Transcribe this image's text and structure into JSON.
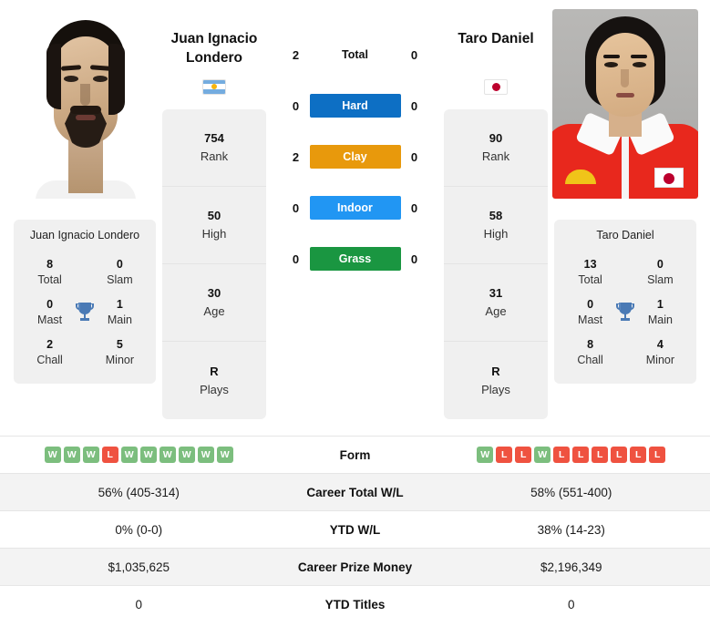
{
  "players": {
    "left": {
      "name": "Juan Ignacio Londero",
      "name_line1": "Juan Ignacio",
      "name_line2": "Londero",
      "country": "Argentina",
      "flag": "argentina-flag",
      "photo_alt": "Juan Ignacio Londero headshot",
      "card": [
        {
          "value": "754",
          "label": "Rank"
        },
        {
          "value": "50",
          "label": "High"
        },
        {
          "value": "30",
          "label": "Age"
        },
        {
          "value": "R",
          "label": "Plays"
        }
      ],
      "titles": {
        "heading": "Juan Ignacio Londero",
        "total": {
          "value": "8",
          "label": "Total"
        },
        "slam": {
          "value": "0",
          "label": "Slam"
        },
        "mast": {
          "value": "0",
          "label": "Mast"
        },
        "main": {
          "value": "1",
          "label": "Main"
        },
        "chall": {
          "value": "2",
          "label": "Chall"
        },
        "minor": {
          "value": "5",
          "label": "Minor"
        }
      },
      "form": [
        "W",
        "W",
        "W",
        "L",
        "W",
        "W",
        "W",
        "W",
        "W",
        "W"
      ],
      "career_total_wl": "56% (405-314)",
      "ytd_wl": "0% (0-0)",
      "career_prize_money": "$1,035,625",
      "ytd_titles": "0"
    },
    "right": {
      "name": "Taro Daniel",
      "name_line1": "Taro Daniel",
      "name_line2": "",
      "country": "Japan",
      "flag": "japan-flag",
      "photo_alt": "Taro Daniel headshot",
      "card": [
        {
          "value": "90",
          "label": "Rank"
        },
        {
          "value": "58",
          "label": "High"
        },
        {
          "value": "31",
          "label": "Age"
        },
        {
          "value": "R",
          "label": "Plays"
        }
      ],
      "titles": {
        "heading": "Taro Daniel",
        "total": {
          "value": "13",
          "label": "Total"
        },
        "slam": {
          "value": "0",
          "label": "Slam"
        },
        "mast": {
          "value": "0",
          "label": "Mast"
        },
        "main": {
          "value": "1",
          "label": "Main"
        },
        "chall": {
          "value": "8",
          "label": "Chall"
        },
        "minor": {
          "value": "4",
          "label": "Minor"
        }
      },
      "form": [
        "W",
        "L",
        "L",
        "W",
        "L",
        "L",
        "L",
        "L",
        "L",
        "L"
      ],
      "career_total_wl": "58% (551-400)",
      "ytd_wl": "38% (14-23)",
      "career_prize_money": "$2,196,349",
      "ytd_titles": "0"
    }
  },
  "h2h": {
    "rows": [
      {
        "label": "Total",
        "left": "2",
        "right": "0",
        "surface": false,
        "color": ""
      },
      {
        "label": "Hard",
        "left": "0",
        "right": "0",
        "surface": true,
        "color": "#0d6fc4"
      },
      {
        "label": "Clay",
        "left": "2",
        "right": "0",
        "surface": true,
        "color": "#e8990c"
      },
      {
        "label": "Indoor",
        "left": "0",
        "right": "0",
        "surface": true,
        "color": "#2196f3"
      },
      {
        "label": "Grass",
        "left": "0",
        "right": "0",
        "surface": true,
        "color": "#1a9641"
      }
    ]
  },
  "table": {
    "rows": [
      {
        "label": "Form",
        "type": "form",
        "alt": false
      },
      {
        "label": "Career Total W/L",
        "type": "text",
        "left": "56% (405-314)",
        "right": "58% (551-400)",
        "alt": true
      },
      {
        "label": "YTD W/L",
        "type": "text",
        "left": "0% (0-0)",
        "right": "38% (14-23)",
        "alt": false
      },
      {
        "label": "Career Prize Money",
        "type": "text",
        "left": "$1,035,625",
        "right": "$2,196,349",
        "alt": true
      },
      {
        "label": "YTD Titles",
        "type": "text",
        "left": "0",
        "right": "0",
        "alt": false
      }
    ]
  },
  "icons": {
    "trophy": "trophy-icon"
  },
  "colors": {
    "hard": "#0d6fc4",
    "clay": "#e8990c",
    "indoor": "#2196f3",
    "grass": "#1a9641",
    "win_badge": "#7cbe7e",
    "loss_badge": "#ef5240",
    "panel_bg": "#f0f0f0",
    "row_alt_bg": "#f3f3f3"
  }
}
